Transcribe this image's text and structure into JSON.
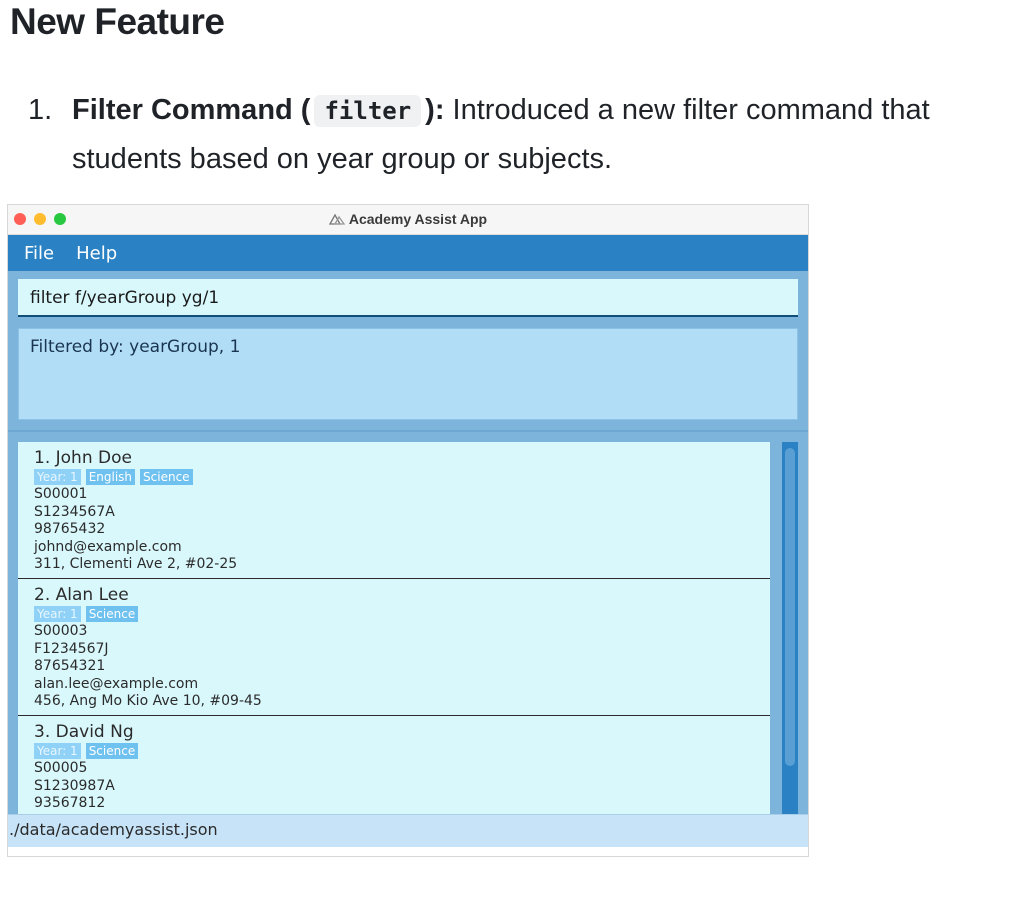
{
  "doc": {
    "heading": "New Feature",
    "feature": {
      "number": "1.",
      "title": "Filter Command (",
      "code": "filter",
      "title_end": "):",
      "text_line1": " Introduced a new filter command that",
      "text_line2": "students based on year group or subjects."
    }
  },
  "app": {
    "window_title": "Academy Assist App",
    "menu": [
      "File",
      "Help"
    ],
    "command_text": "filter f/yearGroup yg/1",
    "result_text": "Filtered by: yearGroup, 1",
    "students": [
      {
        "name": "1. John Doe",
        "tags": [
          "Year: 1",
          "English",
          "Science"
        ],
        "id": "S00001",
        "nric": "S1234567A",
        "phone": "98765432",
        "email": "johnd@example.com",
        "address": "311, Clementi Ave 2, #02-25"
      },
      {
        "name": "2. Alan Lee",
        "tags": [
          "Year: 1",
          "Science"
        ],
        "id": "S00003",
        "nric": "F1234567J",
        "phone": "87654321",
        "email": "alan.lee@example.com",
        "address": "456, Ang Mo Kio Ave 10, #09-45"
      },
      {
        "name": "3. David Ng",
        "tags": [
          "Year: 1",
          "Science"
        ],
        "id": "S00005",
        "nric": "S1230987A",
        "phone": "93567812",
        "email": "",
        "address": ""
      }
    ],
    "status_path": "./data/academyassist.json"
  }
}
